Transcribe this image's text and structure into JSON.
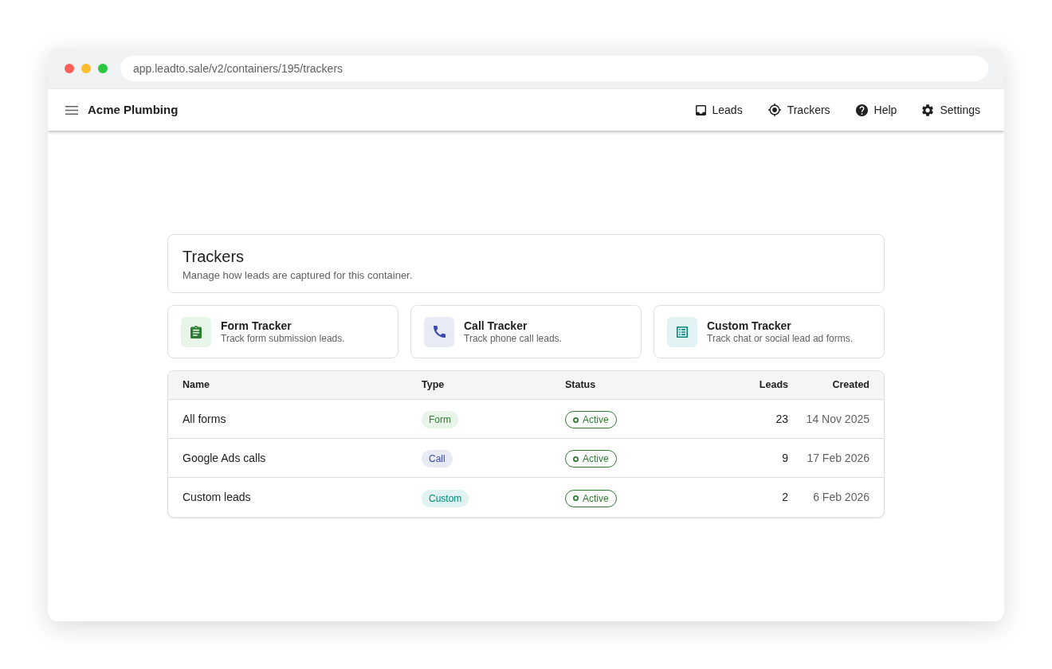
{
  "browser": {
    "url": "app.leadto.sale/v2/containers/195/trackers"
  },
  "app_bar": {
    "title": "Acme Plumbing",
    "nav": [
      {
        "label": "Leads"
      },
      {
        "label": "Trackers"
      },
      {
        "label": "Help"
      },
      {
        "label": "Settings"
      }
    ]
  },
  "header": {
    "title": "Trackers",
    "subtitle": "Manage how leads are captured for this container."
  },
  "tracker_types": [
    {
      "kind": "form",
      "title": "Form Tracker",
      "description": "Track form submission leads."
    },
    {
      "kind": "call",
      "title": "Call Tracker",
      "description": "Track phone call leads."
    },
    {
      "kind": "custom",
      "title": "Custom Tracker",
      "description": "Track chat or social lead ad forms."
    }
  ],
  "table": {
    "columns": [
      "Name",
      "Type",
      "Status",
      "Leads",
      "Created"
    ],
    "rows": [
      {
        "name": "All forms",
        "type": {
          "kind": "form",
          "label": "Form"
        },
        "status": {
          "kind": "active",
          "label": "Active"
        },
        "leads": "23",
        "created": "14 Nov 2025"
      },
      {
        "name": "Google Ads calls",
        "type": {
          "kind": "call",
          "label": "Call"
        },
        "status": {
          "kind": "active",
          "label": "Active"
        },
        "leads": "9",
        "created": "17 Feb 2026"
      },
      {
        "name": "Custom leads",
        "type": {
          "kind": "custom",
          "label": "Custom"
        },
        "status": {
          "kind": "active",
          "label": "Active"
        },
        "leads": "2",
        "created": "6 Feb 2026"
      }
    ]
  }
}
